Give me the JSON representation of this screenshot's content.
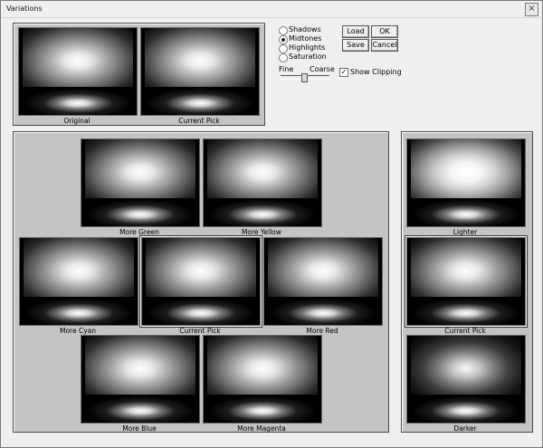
{
  "window": {
    "title": "Variations"
  },
  "top_thumbs": [
    {
      "caption": "Original"
    },
    {
      "caption": "Current Pick"
    }
  ],
  "tone_options": [
    {
      "label": "Shadows",
      "selected": false
    },
    {
      "label": "Midtones",
      "selected": true
    },
    {
      "label": "Highlights",
      "selected": false
    },
    {
      "label": "Saturation",
      "selected": false
    }
  ],
  "buttons": {
    "load": "Load",
    "ok": "OK",
    "save": "Save",
    "cancel": "Cancel"
  },
  "slider": {
    "left_label": "Fine",
    "right_label": "Coarse",
    "position": 0.5
  },
  "show_clipping": {
    "label": "Show Clipping",
    "checked": true
  },
  "color_variations": [
    {
      "caption": "More Green"
    },
    {
      "caption": "More Yellow"
    },
    {
      "caption": "More Cyan"
    },
    {
      "caption": "Current Pick"
    },
    {
      "caption": "More Red"
    },
    {
      "caption": "More Blue"
    },
    {
      "caption": "More Magenta"
    }
  ],
  "brightness_variations": [
    {
      "caption": "Lighter"
    },
    {
      "caption": "Current Pick"
    },
    {
      "caption": "Darker"
    }
  ]
}
